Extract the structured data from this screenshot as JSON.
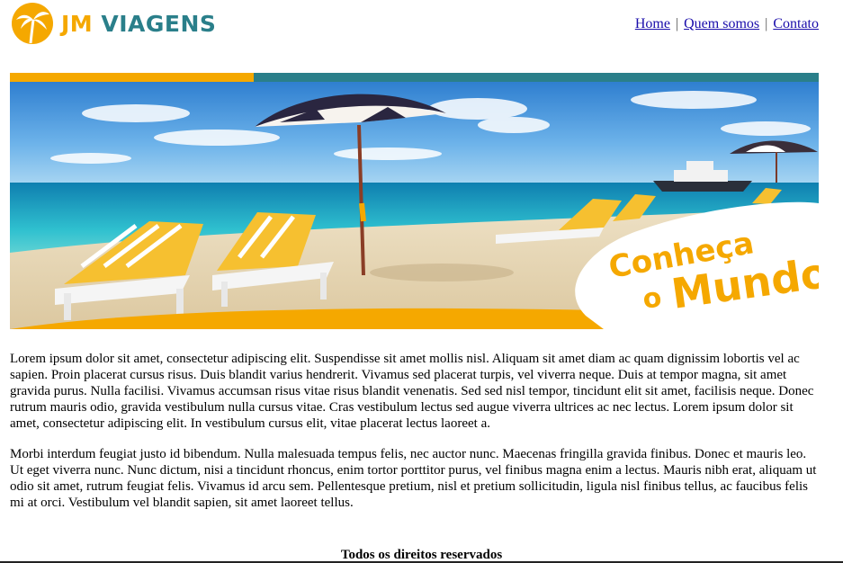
{
  "brand": {
    "name_prefix": "JM",
    "name_suffix": "VIAGENS"
  },
  "colors": {
    "accent": "#f5a800",
    "teal": "#2a7f8a",
    "link": "#1a0dab"
  },
  "nav": {
    "items": [
      {
        "label": "Home"
      },
      {
        "label": "Quem somos"
      },
      {
        "label": "Contato"
      }
    ],
    "separator": "|"
  },
  "banner": {
    "line1": "Conheça",
    "line2": "o",
    "line3": "Mundo"
  },
  "main": {
    "paragraphs": [
      "Lorem ipsum dolor sit amet, consectetur adipiscing elit. Suspendisse sit amet mollis nisl. Aliquam sit amet diam ac quam dignissim lobortis vel ac sapien. Proin placerat cursus risus. Duis blandit varius hendrerit. Vivamus sed placerat turpis, vel viverra neque. Duis at tempor magna, sit amet gravida purus. Nulla facilisi. Vivamus accumsan risus vitae risus blandit venenatis. Sed sed nisl tempor, tincidunt elit sit amet, facilisis neque. Donec rutrum mauris odio, gravida vestibulum nulla cursus vitae. Cras vestibulum lectus sed augue viverra ultrices ac nec lectus. Lorem ipsum dolor sit amet, consectetur adipiscing elit. In vestibulum cursus elit, vitae placerat lectus laoreet a.",
      "Morbi interdum feugiat justo id bibendum. Nulla malesuada tempus felis, nec auctor nunc. Maecenas fringilla gravida finibus. Donec et mauris leo. Ut eget viverra nunc. Nunc dictum, nisi a tincidunt rhoncus, enim tortor porttitor purus, vel finibus magna enim a lectus. Mauris nibh erat, aliquam ut odio sit amet, rutrum feugiat felis. Vivamus id arcu sem. Pellentesque pretium, nisl et pretium sollicitudin, ligula nisl finibus tellus, ac faucibus felis mi at orci. Vestibulum vel blandit sapien, sit amet laoreet tellus."
    ]
  },
  "footer": {
    "text": "Todos os direitos reservados"
  }
}
